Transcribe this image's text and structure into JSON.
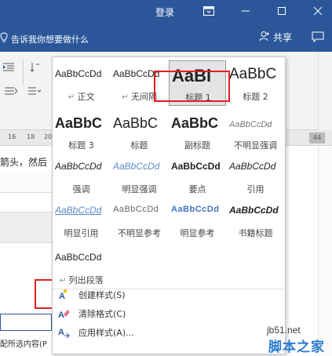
{
  "titlebar": {
    "login": "登录"
  },
  "tellbar": {
    "tell_me": "告诉我你想要做什么",
    "share": "共享"
  },
  "ruler": {
    "ticks": [
      "16",
      "18",
      "20",
      "44"
    ]
  },
  "document": {
    "text": "箭头，然后",
    "field_text": "配所选内容(P"
  },
  "styles_gallery": {
    "tiles": [
      {
        "sample": "AaBbCcDd",
        "name": "正文",
        "para_mark": "↵",
        "style": "s-body"
      },
      {
        "sample": "AaBbCcDd",
        "name": "无间隔",
        "para_mark": "↵",
        "style": "s-body"
      },
      {
        "sample": "AaBl",
        "name": "标题 1",
        "para_mark": "",
        "style": "s-h1",
        "selected": true
      },
      {
        "sample": "AaBbC",
        "name": "标题 2",
        "para_mark": "",
        "style": "s-h2"
      },
      {
        "sample": "AaBbC",
        "name": "标题 3",
        "para_mark": "",
        "style": "s-h3"
      },
      {
        "sample": "AaBbC",
        "name": "标题",
        "para_mark": "",
        "style": "s-title"
      },
      {
        "sample": "AaBbC",
        "name": "副标题",
        "para_mark": "",
        "style": "s-sub"
      },
      {
        "sample": "AaBbCcDd",
        "name": "不明显强调",
        "para_mark": "",
        "style": "s-subtle"
      },
      {
        "sample": "AaBbCcDd",
        "name": "强调",
        "para_mark": "",
        "style": "s-emph"
      },
      {
        "sample": "AaBbCcDd",
        "name": "明显强调",
        "para_mark": "",
        "style": "s-iemph"
      },
      {
        "sample": "AaBbCcDd",
        "name": "要点",
        "para_mark": "",
        "style": "s-strong"
      },
      {
        "sample": "AaBbCcDd",
        "name": "引用",
        "para_mark": "",
        "style": "s-quote"
      },
      {
        "sample": "AaBbCcDd",
        "name": "明显引用",
        "para_mark": "",
        "style": "s-iquote"
      },
      {
        "sample": "AaBbCcDd",
        "name": "不明显参考",
        "para_mark": "",
        "style": "s-sref"
      },
      {
        "sample": "AaBbCcDd",
        "name": "明显参考",
        "para_mark": "",
        "style": "s-iref"
      },
      {
        "sample": "AaBbCcDd",
        "name": "书籍标题",
        "para_mark": "",
        "style": "s-book"
      },
      {
        "sample": "AaBbCcDd",
        "name": "列出段落",
        "para_mark": "↵",
        "style": "s-list"
      }
    ],
    "menu": {
      "create_style": "创建样式(S)",
      "clear_format": "清除格式(C)",
      "apply_style": "应用样式(A)..."
    }
  },
  "colors": {
    "brand_blue": "#2b579a",
    "highlight_red": "#e02020"
  },
  "watermark": {
    "site": "jb51.net",
    "name": "脚本之家"
  }
}
